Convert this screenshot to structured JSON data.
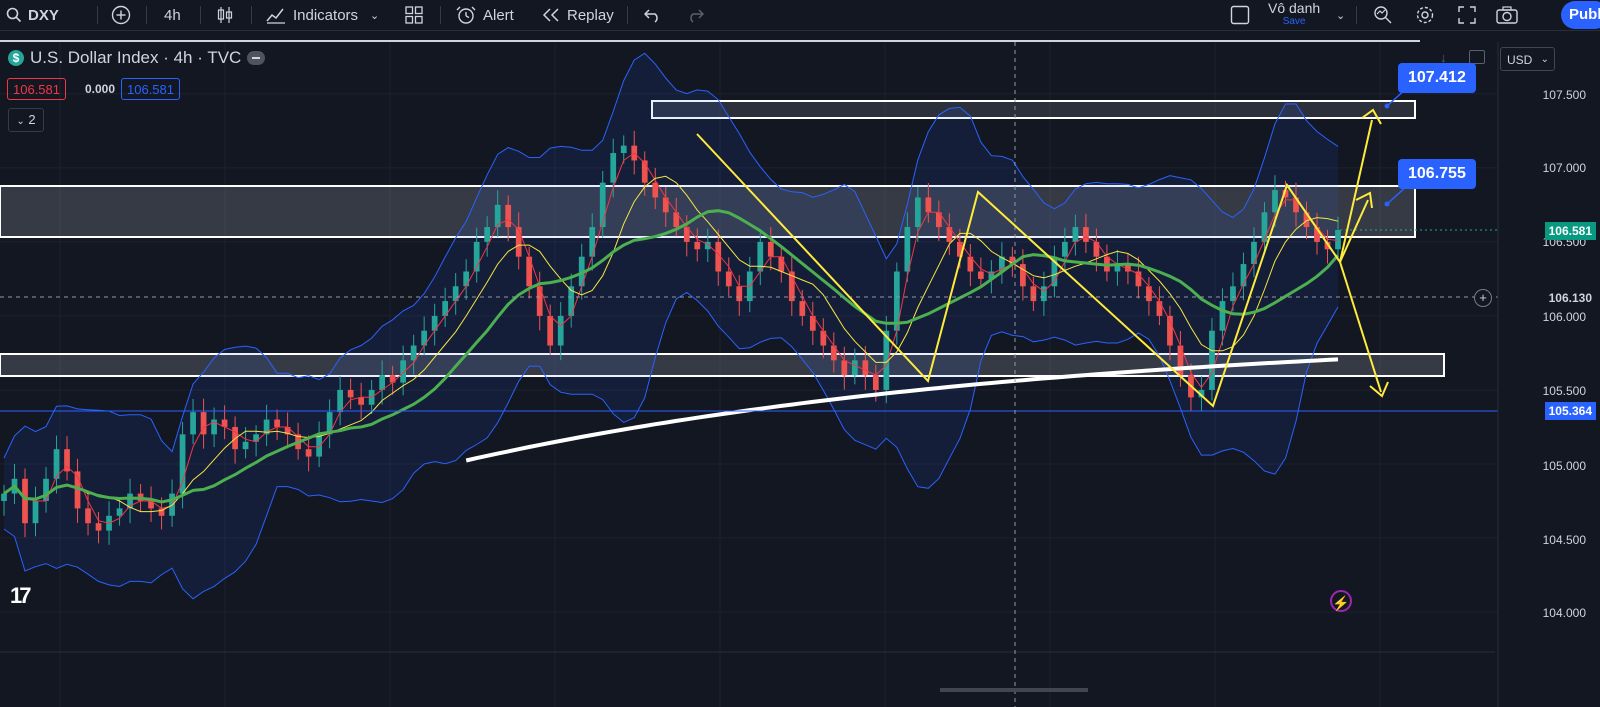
{
  "toolbar": {
    "symbol": "DXY",
    "interval": "4h",
    "indicators_label": "Indicators",
    "alert_label": "Alert",
    "replay_label": "Replay",
    "layout_name": "Vô danh",
    "save_label": "Save",
    "publish_label": "Publish"
  },
  "legend": {
    "title": "U.S. Dollar Index · 4h · TVC",
    "sell_price": "106.581",
    "spread": "0.000",
    "buy_price": "106.581",
    "indicators_count": "2"
  },
  "currency": "USD",
  "price_scale": {
    "ticks": [
      "107.500",
      "107.000",
      "106.500",
      "106.000",
      "105.500",
      "105.000",
      "104.500",
      "104.000"
    ],
    "current_price": "106.581",
    "crosshair_price": "106.130",
    "support_price": "105.364"
  },
  "annotations": {
    "target_high": "107.412",
    "target_mid": "106.755"
  },
  "colors": {
    "background": "#131722",
    "bull": "#26a69a",
    "bear": "#ef5350",
    "ma_green": "#4caf50",
    "ma_white": "#ffffff",
    "ma_yellow": "#f5e642",
    "ma_red": "#f23645",
    "bollinger": "#2962ff",
    "pattern": "#ffeb3b",
    "accent": "#2962ff"
  },
  "chart_data": {
    "type": "candlestick",
    "symbol": "DXY",
    "interval": "4h",
    "ylim": [
      103.98,
      107.85
    ],
    "close_series": [
      104.8,
      104.9,
      104.6,
      104.75,
      104.9,
      105.1,
      104.95,
      104.7,
      104.6,
      104.55,
      104.65,
      104.7,
      104.8,
      104.75,
      104.7,
      104.65,
      104.8,
      105.2,
      105.35,
      105.2,
      105.3,
      105.25,
      105.1,
      105.15,
      105.2,
      105.3,
      105.25,
      105.2,
      105.1,
      105.05,
      105.2,
      105.35,
      105.5,
      105.45,
      105.4,
      105.5,
      105.6,
      105.55,
      105.7,
      105.8,
      105.9,
      106.0,
      106.1,
      106.2,
      106.3,
      106.5,
      106.6,
      106.75,
      106.6,
      106.4,
      106.2,
      106.0,
      105.8,
      106.0,
      106.2,
      106.4,
      106.6,
      106.9,
      107.1,
      107.15,
      107.05,
      106.9,
      106.8,
      106.7,
      106.6,
      106.5,
      106.45,
      106.5,
      106.3,
      106.2,
      106.1,
      106.3,
      106.5,
      106.4,
      106.3,
      106.1,
      106.0,
      105.9,
      105.8,
      105.7,
      105.6,
      105.7,
      105.6,
      105.5,
      105.9,
      106.3,
      106.6,
      106.8,
      106.7,
      106.6,
      106.5,
      106.4,
      106.3,
      106.25,
      106.3,
      106.4,
      106.35,
      106.2,
      106.1,
      106.2,
      106.4,
      106.5,
      106.6,
      106.5,
      106.4,
      106.3,
      106.35,
      106.3,
      106.2,
      106.1,
      106.0,
      105.8,
      105.6,
      105.45,
      105.5,
      105.9,
      106.1,
      106.2,
      106.35,
      106.5,
      106.7,
      106.85,
      106.8,
      106.7,
      106.6,
      106.5,
      106.45,
      106.58
    ]
  }
}
